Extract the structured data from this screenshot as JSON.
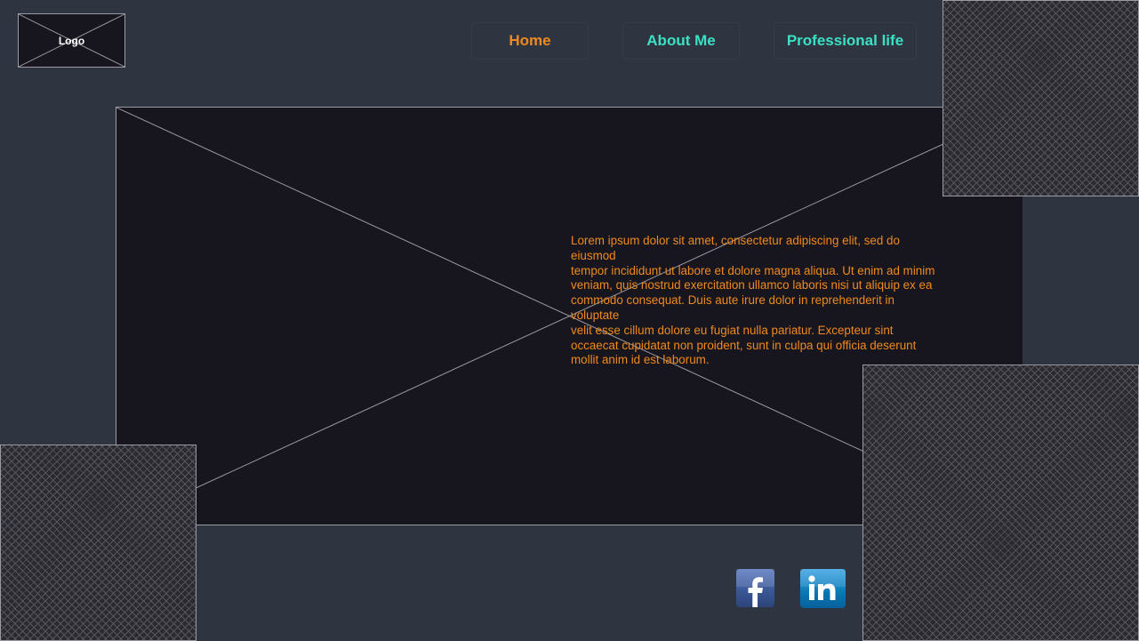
{
  "logo": {
    "label": "Logo"
  },
  "nav": {
    "items": [
      {
        "label": "Home",
        "active": true
      },
      {
        "label": "About Me",
        "active": false
      },
      {
        "label": "Professional life",
        "active": false
      }
    ],
    "active_color": "#f08a1e",
    "inactive_color": "#3ce0c4"
  },
  "hero": {
    "text": "Lorem ipsum dolor sit amet, consectetur adipiscing elit, sed do eiusmod\ntempor incididunt ut labore et dolore magna aliqua. Ut enim ad minim\nveniam, quis nostrud exercitation ullamco laboris nisi ut aliquip ex ea\ncommodo consequat. Duis aute irure dolor in reprehenderit in voluptate\nvelit esse cillum dolore eu fugiat nulla pariatur. Excepteur sint\noccaecat cupidatat non proident, sunt in culpa qui officia deserunt\nmollit anim id est laborum."
  },
  "social": [
    {
      "icon": "facebook-icon",
      "glyph": "f"
    },
    {
      "icon": "linkedin-icon",
      "glyph": "in"
    }
  ],
  "colors": {
    "background": "#2e3540",
    "placeholder": "#17151d",
    "text_accent": "#f08a1e"
  }
}
